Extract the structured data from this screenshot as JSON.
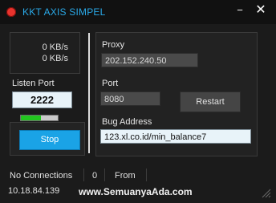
{
  "window": {
    "title": "KKT AXIS SIMPEL",
    "icon": "red-circle-icon",
    "minimize_glyph": "−",
    "close_glyph": "✕"
  },
  "speed": {
    "upload": "0 KB/s",
    "download": "0 KB/s"
  },
  "listen_port": {
    "label": "Listen Port",
    "value": "2222",
    "progress_fraction": 0.55
  },
  "buttons": {
    "stop": "Stop",
    "restart": "Restart"
  },
  "proxy": {
    "label": "Proxy",
    "value": "202.152.240.50"
  },
  "port": {
    "label": "Port",
    "value": "8080"
  },
  "bug_address": {
    "label": "Bug Address",
    "value": "123.xl.co.id/min_balance7"
  },
  "status": {
    "connections": "No Connections",
    "count": "0",
    "from": "From",
    "ip": "10.18.84.139"
  },
  "watermark": "www.SemuanyaAda.com",
  "colors": {
    "accent": "#1aa3e6",
    "title": "#2aa9e8",
    "progress": "#22c61f",
    "icon": "#e8332d"
  }
}
